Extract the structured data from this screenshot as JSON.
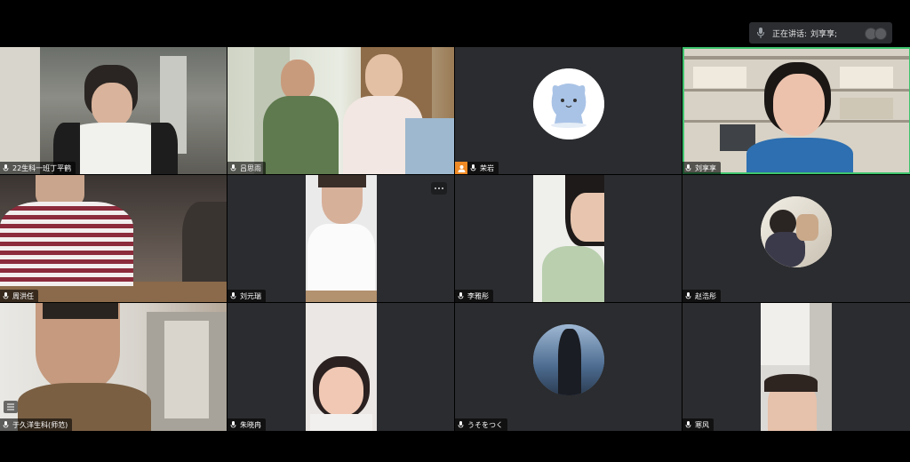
{
  "speaking": {
    "label": "正在讲话:",
    "name": "刘享享;"
  },
  "participants": [
    {
      "name": "22生科一班丁平鹤",
      "camera": "on"
    },
    {
      "name": "吕思雨",
      "camera": "on"
    },
    {
      "name": "荣岩",
      "camera": "off",
      "avatar": "cartoon-cat",
      "host": true
    },
    {
      "name": "刘享享",
      "camera": "on",
      "speaking": true
    },
    {
      "name": "周洪任",
      "camera": "on"
    },
    {
      "name": "刘元瑞",
      "camera": "on"
    },
    {
      "name": "李雅彤",
      "camera": "on"
    },
    {
      "name": "赵浩彤",
      "camera": "off",
      "avatar": "photo"
    },
    {
      "name": "于久洋生科(师范)",
      "camera": "on"
    },
    {
      "name": "朱晓冉",
      "camera": "on"
    },
    {
      "name": "うそをつく",
      "camera": "off",
      "avatar": "photo"
    },
    {
      "name": "寒风",
      "camera": "on"
    }
  ],
  "colors": {
    "active_border": "#3ec46d",
    "tile_bg": "#2b2c2f",
    "host_badge": "#f08a24"
  }
}
